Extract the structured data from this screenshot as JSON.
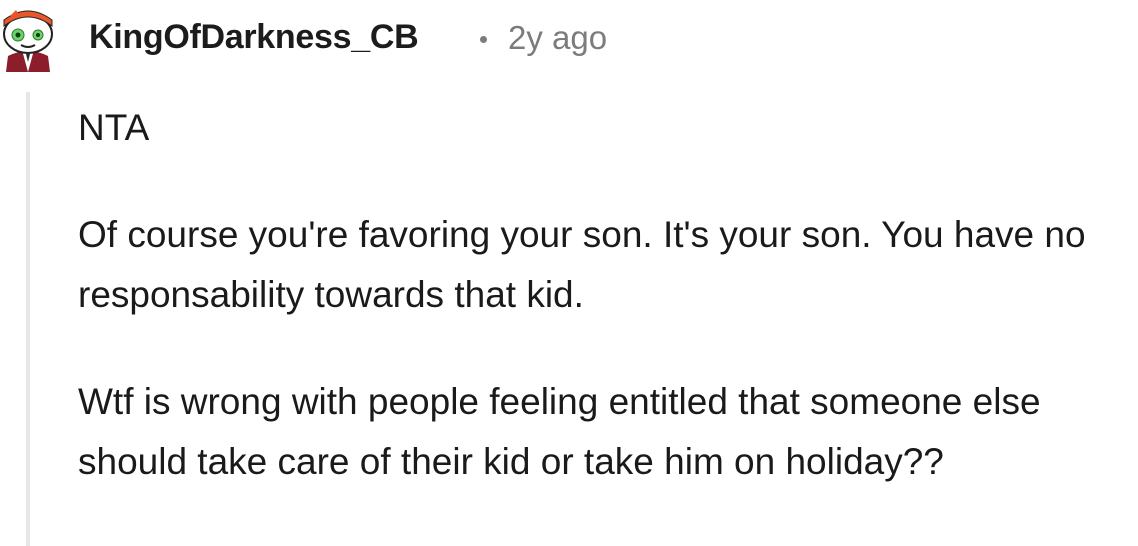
{
  "comment": {
    "author": "KingOfDarkness_CB",
    "timestamp": "2y ago",
    "paragraphs": [
      "NTA",
      "Of course you're favoring your son. It's your son. You have no responsability towards that kid.",
      "Wtf is wrong with people feeling entitled that someone else should take care of their kid or take him on holiday??"
    ]
  },
  "icons": {
    "avatar": "snoo-avatar-icon",
    "separator": "dot-separator"
  },
  "colors": {
    "username": "#1c1c1c",
    "meta": "#7c7c7c",
    "body_text": "#1a1a1b",
    "thread_line": "#e7e7e7",
    "avatar_headband": "#e8562a",
    "avatar_eye": "#6fd26f",
    "avatar_shirt": "#8b1e2a"
  }
}
